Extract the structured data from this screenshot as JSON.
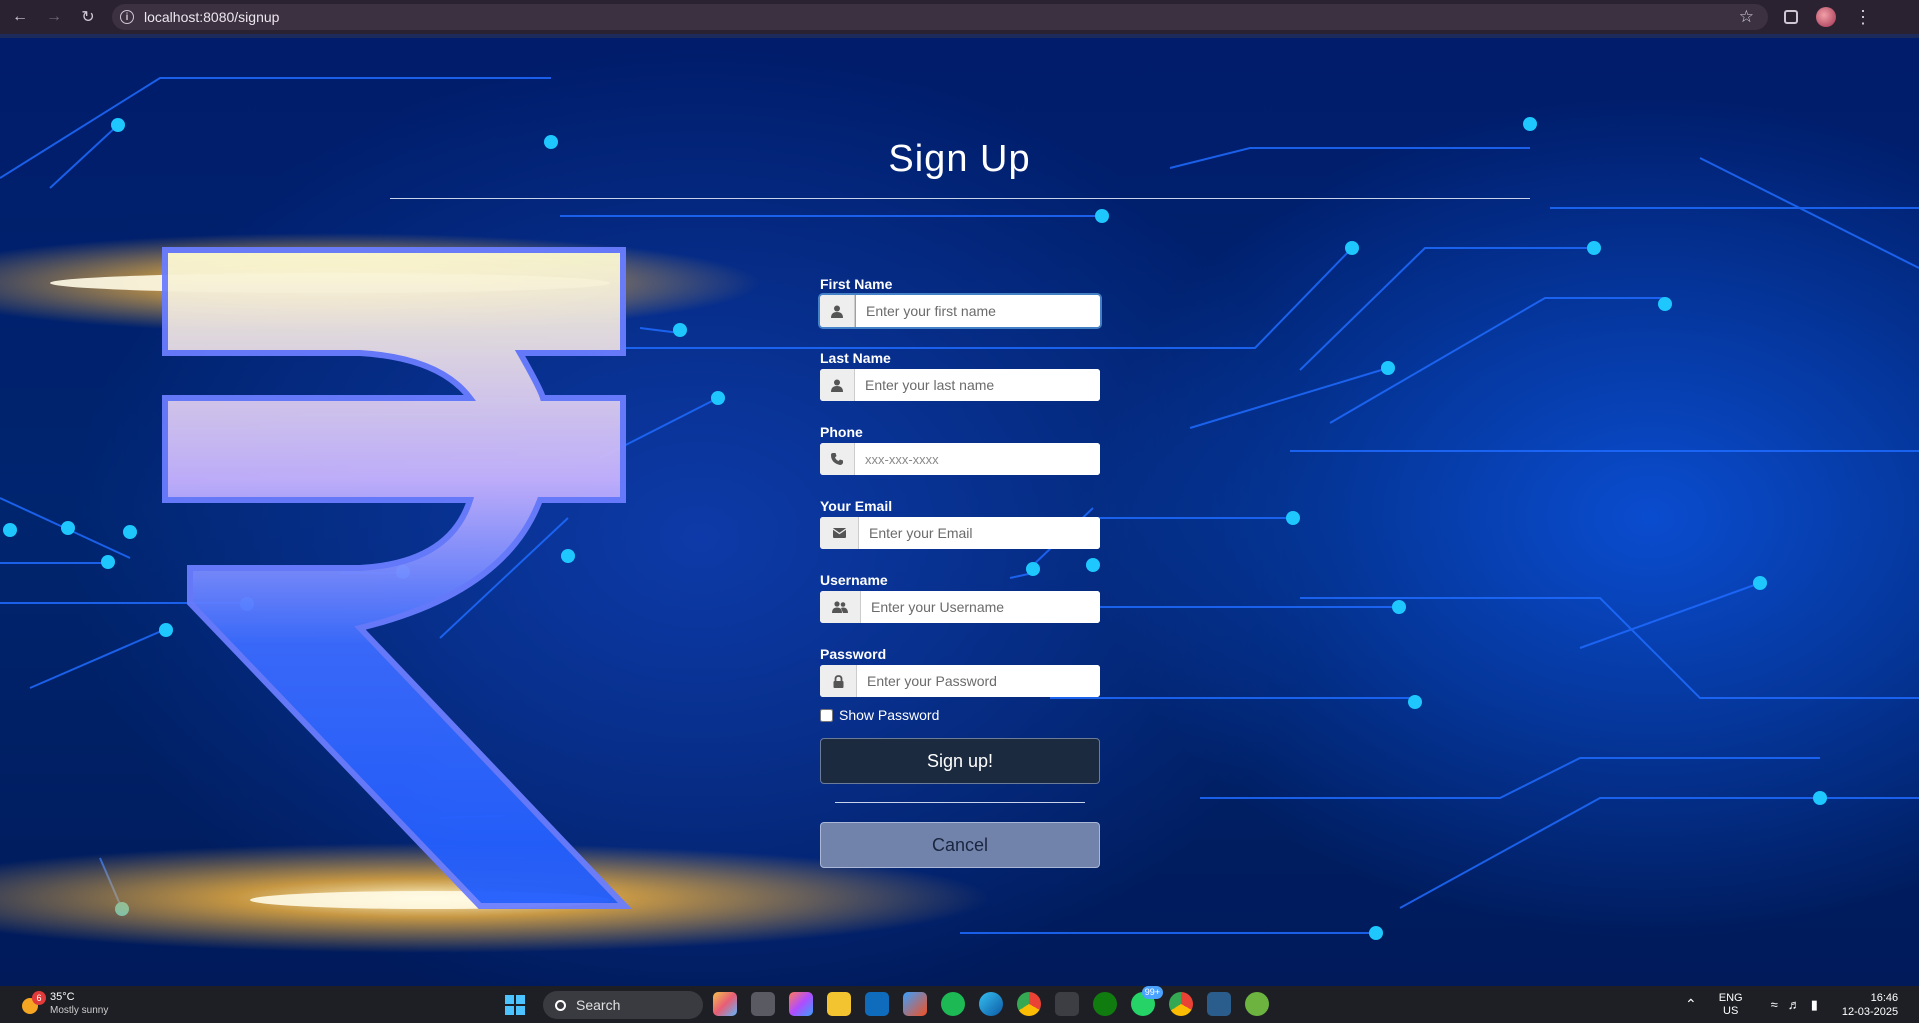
{
  "browser": {
    "url": "localhost:8080/signup",
    "icons": [
      "back-icon",
      "forward-icon",
      "reload-icon",
      "info-icon",
      "star-icon",
      "extensions-icon",
      "profile-avatar",
      "menu-icon"
    ]
  },
  "page": {
    "title": "Sign Up",
    "background_colors": {
      "deep": "#001c6b",
      "mid": "#0a4ccf",
      "glow": "#f7b53b",
      "accent": "#1ec8ff"
    }
  },
  "form": {
    "first_name": {
      "label": "First Name",
      "placeholder": "Enter your first name",
      "icon": "user-icon"
    },
    "last_name": {
      "label": "Last Name",
      "placeholder": "Enter your last name",
      "icon": "user-icon"
    },
    "phone": {
      "label": "Phone",
      "placeholder": "xxx-xxx-xxxx",
      "icon": "phone-icon"
    },
    "email": {
      "label": "Your Email",
      "placeholder": "Enter your Email",
      "icon": "envelope-icon"
    },
    "username": {
      "label": "Username",
      "placeholder": "Enter your Username",
      "icon": "users-icon"
    },
    "password": {
      "label": "Password",
      "placeholder": "Enter your Password",
      "icon": "lock-icon"
    },
    "show_password_label": "Show Password",
    "show_password_checked": false,
    "signup_label": "Sign up!",
    "cancel_label": "Cancel"
  },
  "taskbar": {
    "weather_badge": "6",
    "temperature": "35°C",
    "condition": "Mostly sunny",
    "search_label": "Search",
    "whatsapp_badge": "99+",
    "language": "ENG",
    "region": "US",
    "time": "16:46",
    "date": "12-03-2025"
  }
}
